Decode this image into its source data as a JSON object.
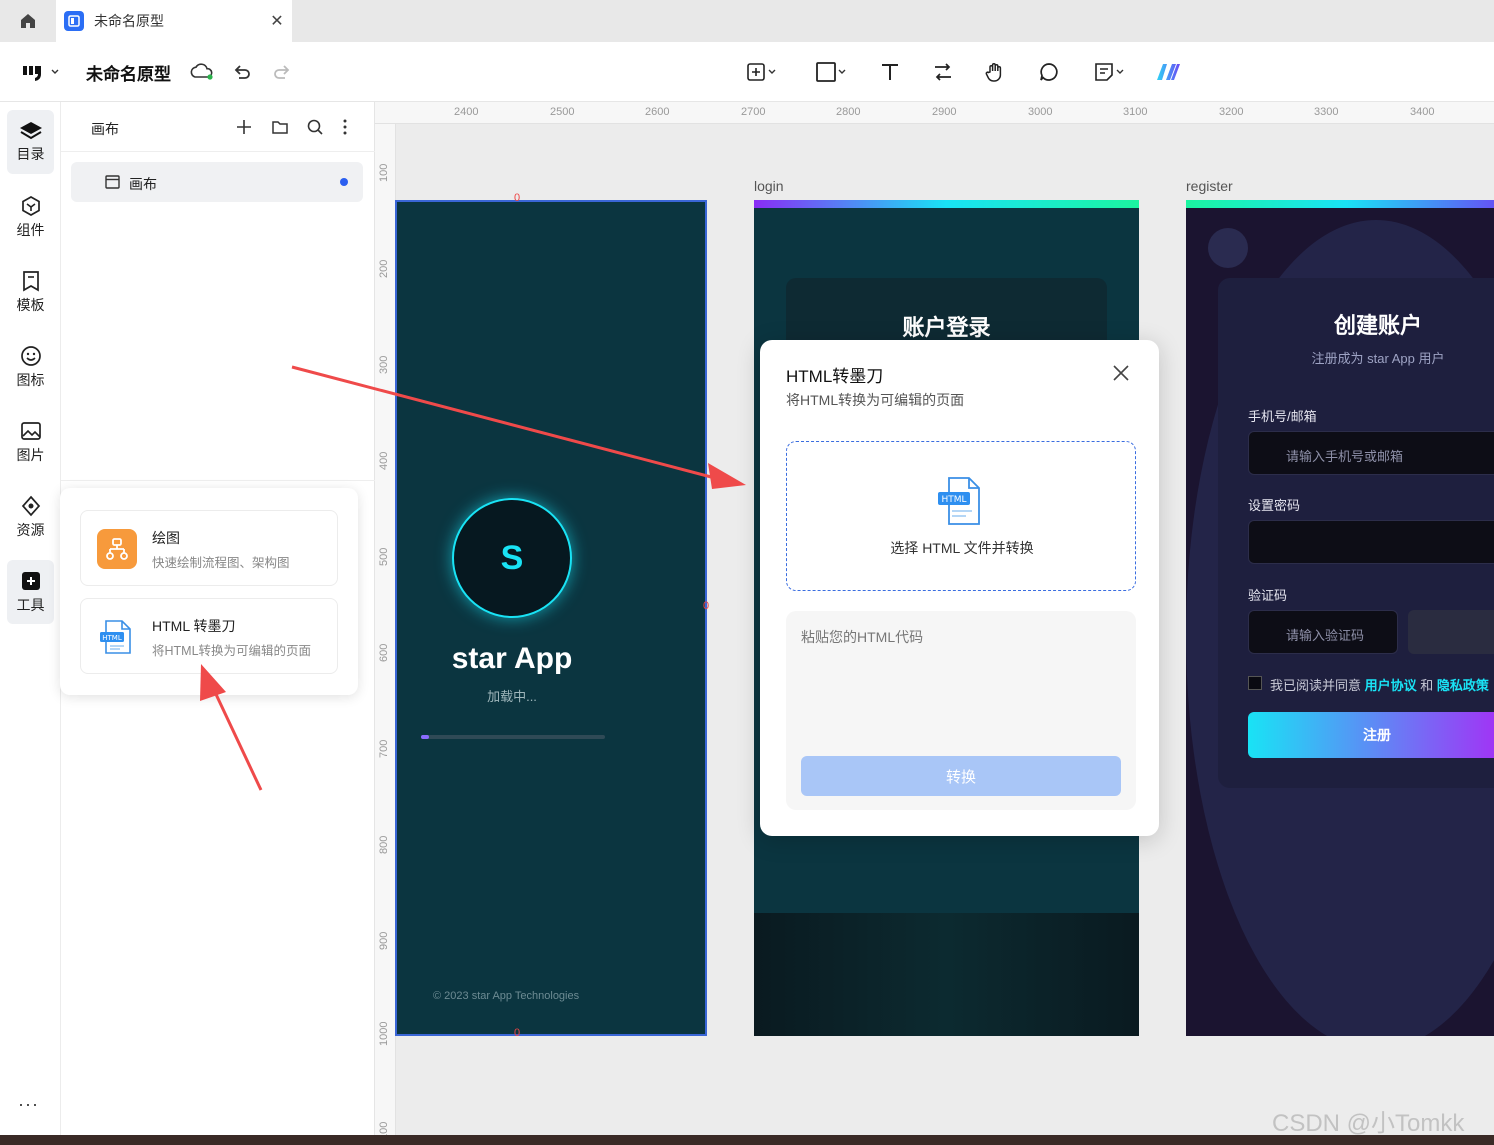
{
  "tabbar": {
    "tab_title": "未命名原型"
  },
  "toolbar": {
    "doc_title": "未命名原型"
  },
  "rail": {
    "items": [
      {
        "label": "目录",
        "icon": "layers-icon"
      },
      {
        "label": "组件",
        "icon": "component-icon"
      },
      {
        "label": "模板",
        "icon": "template-icon"
      },
      {
        "label": "图标",
        "icon": "smiley-icon"
      },
      {
        "label": "图片",
        "icon": "image-icon"
      },
      {
        "label": "资源",
        "icon": "resource-icon"
      },
      {
        "label": "工具",
        "icon": "tool-icon"
      }
    ],
    "more": "···"
  },
  "layers": {
    "title": "画布",
    "canvas_item": "画布"
  },
  "tools_popup": {
    "items": [
      {
        "title": "绘图",
        "subtitle": "快速绘制流程图、架构图"
      },
      {
        "title": "HTML 转墨刀",
        "subtitle": "将HTML转换为可编辑的页面"
      }
    ]
  },
  "ruler": {
    "top": [
      "2400",
      "2500",
      "2600",
      "2700",
      "2800",
      "2900",
      "3000",
      "3100",
      "3200",
      "3300",
      "3400"
    ],
    "left": [
      "100",
      "200",
      "300",
      "400",
      "500",
      "600",
      "700",
      "800",
      "900",
      "1000",
      "100"
    ]
  },
  "frames": {
    "splash": {
      "marker": "0",
      "logo_letter": "S",
      "app_name": "star App",
      "loading": "加载中...",
      "copyright": "© 2023 star App Technologies"
    },
    "login": {
      "label": "login",
      "heading": "账户登录"
    },
    "register": {
      "label": "register",
      "heading": "创建账户",
      "subtitle": "注册成为 star App 用户",
      "phone_label": "手机号/邮箱",
      "phone_placeholder": "请输入手机号或邮箱",
      "password_label": "设置密码",
      "code_label": "验证码",
      "code_placeholder": "请输入验证码",
      "agree_prefix": "我已阅读并同意",
      "agree_terms": "用户协议",
      "agree_and": "和",
      "agree_privacy": "隐私政策",
      "submit": "注册"
    }
  },
  "dialog": {
    "title": "HTML转墨刀",
    "subtitle": "将HTML转换为可编辑的页面",
    "file_badge": "HTML",
    "drop_label": "选择 HTML 文件并转换",
    "paste_placeholder": "粘贴您的HTML代码",
    "convert_button": "转换"
  },
  "watermark": "CSDN @小Tomkk",
  "colors": {
    "accent_blue": "#2b6ef5",
    "frame_teal": "#0b3540",
    "register_dark": "#1b1430",
    "cyan": "#19e3f5",
    "arrow_red": "#ef4a4a",
    "button_disabled": "#a9c6f7"
  }
}
